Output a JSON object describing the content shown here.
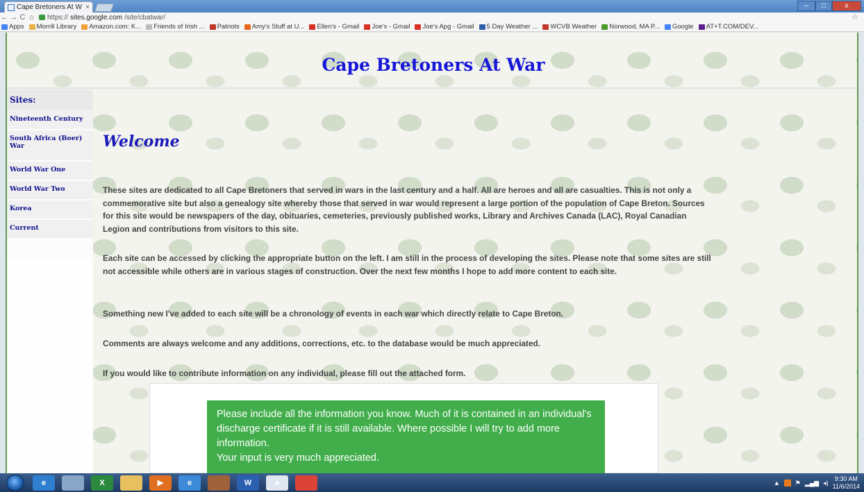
{
  "browser": {
    "tab_title": "Cape Bretoners At W",
    "tab_close": "×",
    "url_prefix": "https://",
    "url_host": "sites.google.com",
    "url_path": "/site/cbatwar/",
    "window_buttons": {
      "minimize": "–",
      "maximize": "□",
      "close": "x"
    }
  },
  "bookmarks": [
    {
      "label": "Apps",
      "color": "#4285f4"
    },
    {
      "label": "Morrill Library",
      "color": "#e8b24a"
    },
    {
      "label": "Amazon.com: K...",
      "color": "#f2a33a"
    },
    {
      "label": "Friends of Irish ...",
      "color": "#bbbbbb"
    },
    {
      "label": "Patriots",
      "color": "#c0392b"
    },
    {
      "label": "Amy's Stuff at U...",
      "color": "#e8681e"
    },
    {
      "label": "Ellen's - Gmail",
      "color": "#d93025"
    },
    {
      "label": "Joe's - Gmail",
      "color": "#d93025"
    },
    {
      "label": "Joe's Apg - Gmail",
      "color": "#d93025"
    },
    {
      "label": "5 Day Weather ...",
      "color": "#2d5fa8"
    },
    {
      "label": "WCVB Weather",
      "color": "#c0392b"
    },
    {
      "label": "Norwood, MA P...",
      "color": "#4c9a2a"
    },
    {
      "label": "Google",
      "color": "#4285f4"
    },
    {
      "label": "AT+T.COM/DEV...",
      "color": "#5d1f8f"
    }
  ],
  "site": {
    "title": "Cape Bretoners At War",
    "sidebar_heading": "Sites:",
    "sidebar_items": [
      "Nineteenth Century",
      "South Africa (Boer) War",
      "World War One",
      "World War Two",
      "Korea",
      "Current"
    ],
    "welcome": "Welcome",
    "paragraphs": [
      "These sites are dedicated to all Cape Bretoners that served in wars in the last century and a half. All are heroes and all are casualties. This is not only a commemorative site but also a genealogy site whereby those that served in war would represent a large portion of the population of Cape Breton. Sources for this site would be newspapers of the day, obituaries, cemeteries, previously published works, Library and Archives Canada (LAC), Royal Canadian Legion and contributions from visitors to this site.",
      "Each site can be accessed by clicking the appropriate button on the left. I am still in the process of developing the sites. Please note that some sites are still not accessible while others are in various stages of construction. Over the next few months I hope to add more content to each site.",
      "Something new I've added to each site will be a chronology of events in each war which directly relate to Cape Breton.",
      "Comments are always welcome and any additions, corrections, etc. to the database would be much appreciated.",
      "If you would like to contribute information on any individual, please fill out the attached form."
    ],
    "form_notice": [
      "Please include all the information you know. Much of it is contained in an individual's discharge certificate if it is still available. Where possible I will try to add more information.",
      "Your input is very much appreciated."
    ],
    "accent_color": "#1616d8",
    "notice_color": "#41ae4b"
  },
  "taskbar": {
    "apps": [
      {
        "name": "ie-icon",
        "label": "e",
        "color": "#2f7fd1"
      },
      {
        "name": "calculator-icon",
        "label": "",
        "color": "#8aa6c7"
      },
      {
        "name": "excel-icon",
        "label": "X",
        "color": "#2c8a3f"
      },
      {
        "name": "folder-icon",
        "label": "",
        "color": "#e9c060"
      },
      {
        "name": "media-player-icon",
        "label": "▶",
        "color": "#e07020"
      },
      {
        "name": "edge-icon",
        "label": "e",
        "color": "#3d8ad8"
      },
      {
        "name": "photo-icon",
        "label": "",
        "color": "#a0623a"
      },
      {
        "name": "word-icon",
        "label": "W",
        "color": "#2b5faf"
      },
      {
        "name": "solitaire-icon",
        "label": "♠",
        "color": "#dfe6ef"
      },
      {
        "name": "chrome-icon",
        "label": "",
        "color": "#db4437"
      }
    ],
    "time": "9:30 AM",
    "date": "11/6/2014"
  }
}
